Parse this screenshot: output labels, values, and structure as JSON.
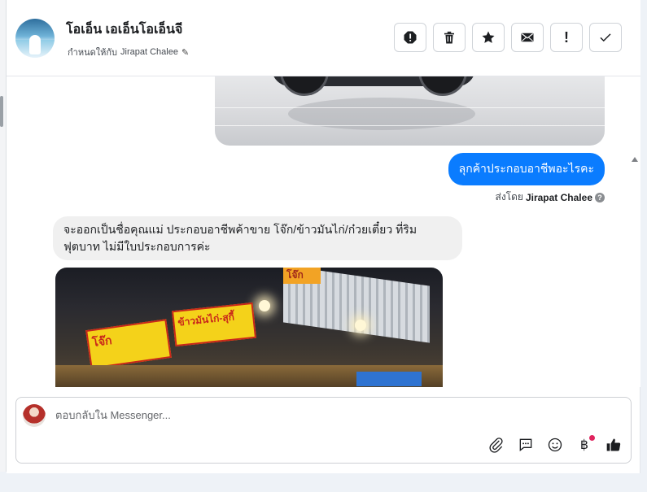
{
  "header": {
    "contact_name": "โอเอ็น เอเอ็นโอเอ็นจี",
    "assigned_prefix": "กำหนดให้กับ",
    "assigned_to": "Jirapat Chalee"
  },
  "toolbar": {
    "buttons": [
      {
        "icon": "spam-icon",
        "label": ""
      },
      {
        "icon": "trash-icon",
        "label": ""
      },
      {
        "icon": "star-icon",
        "label": ""
      },
      {
        "icon": "envelope-icon",
        "label": ""
      },
      {
        "icon": "exclamation-icon",
        "label": "!"
      },
      {
        "icon": "checkmark-icon",
        "label": ""
      }
    ]
  },
  "messages": {
    "outgoing_text": "ลุกค้าประกอบอาชีพอะไรคะ",
    "sent_by_prefix": "ส่งโดย",
    "sent_by_name": "Jirapat Chalee",
    "incoming_text": "จะออกเป็นชื่อคุณแม่ ประกอบอาชีพค้าขาย โจ๊ก/ข้าวมันไก่/ก๋วยเตี๋ยว ที่ริมฟุตบาท ไม่มีใบประกอบการค่ะ",
    "food_image": {
      "sign_left": "โจ๊ก",
      "sign_mid": "ข้าวมันไก่-สุกี้",
      "sign_top": "โจ๊ก"
    }
  },
  "composer": {
    "placeholder": "ตอบกลับใน Messenger...",
    "currency_symbol": "฿",
    "tools": [
      "paperclip-icon",
      "chat-bubble-icon",
      "emoji-icon",
      "baht-icon",
      "thumbs-up-icon"
    ]
  },
  "colors": {
    "outgoing_bubble": "#0a7cff",
    "incoming_bubble": "#f0f0f0",
    "notification_dot": "#e0245e"
  }
}
